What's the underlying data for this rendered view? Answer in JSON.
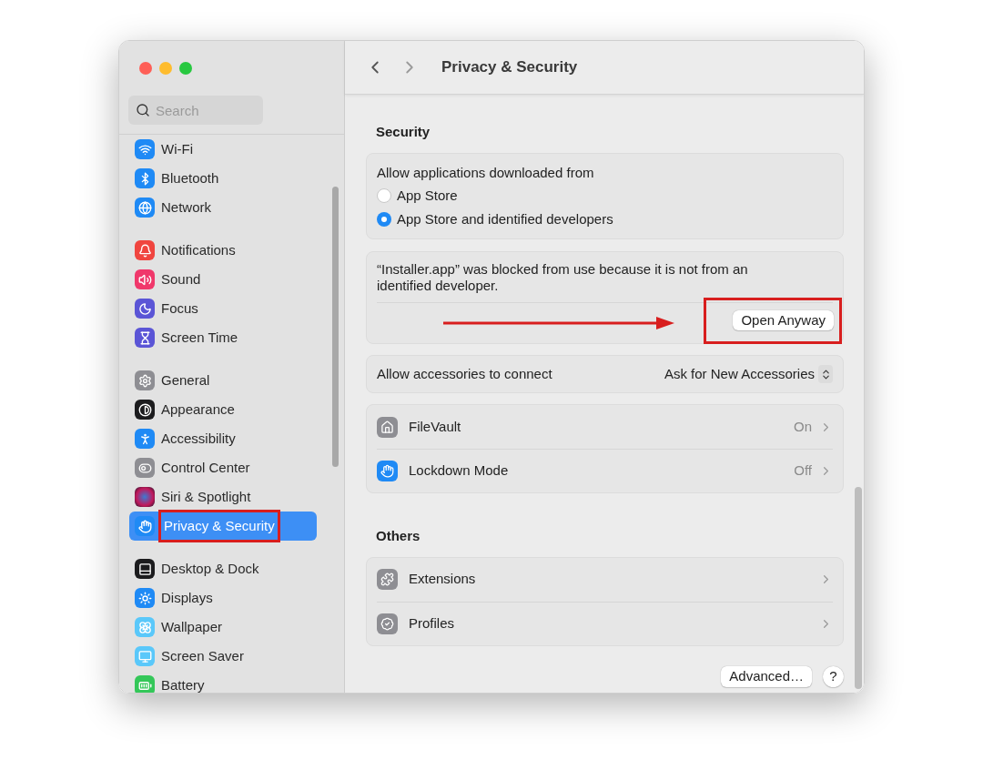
{
  "sidebar": {
    "search": {
      "placeholder": "Search"
    },
    "groups": [
      [
        {
          "label": "Wi-Fi",
          "selected": false
        },
        {
          "label": "Bluetooth",
          "selected": false
        },
        {
          "label": "Network",
          "selected": false
        }
      ],
      [
        {
          "label": "Notifications",
          "selected": false
        },
        {
          "label": "Sound",
          "selected": false
        },
        {
          "label": "Focus",
          "selected": false
        },
        {
          "label": "Screen Time",
          "selected": false
        }
      ],
      [
        {
          "label": "General",
          "selected": false
        },
        {
          "label": "Appearance",
          "selected": false
        },
        {
          "label": "Accessibility",
          "selected": false
        },
        {
          "label": "Control Center",
          "selected": false
        },
        {
          "label": "Siri & Spotlight",
          "selected": false
        },
        {
          "label": "Privacy & Security",
          "selected": true
        }
      ],
      [
        {
          "label": "Desktop & Dock",
          "selected": false
        },
        {
          "label": "Displays",
          "selected": false
        },
        {
          "label": "Wallpaper",
          "selected": false
        },
        {
          "label": "Screen Saver",
          "selected": false
        },
        {
          "label": "Battery",
          "selected": false
        }
      ]
    ]
  },
  "header": {
    "title": "Privacy & Security"
  },
  "security": {
    "heading": "Security",
    "downloads": {
      "label": "Allow applications downloaded from",
      "options": [
        {
          "label": "App Store",
          "selected": false
        },
        {
          "label": "App Store and identified developers",
          "selected": true
        }
      ]
    },
    "blocked": {
      "message": "“Installer.app” was blocked from use because it is not from an identified developer.",
      "button": "Open Anyway"
    },
    "accessories": {
      "label": "Allow accessories to connect",
      "value": "Ask for New Accessories"
    },
    "rows": [
      {
        "label": "FileVault",
        "value": "On"
      },
      {
        "label": "Lockdown Mode",
        "value": "Off"
      }
    ]
  },
  "others": {
    "heading": "Others",
    "rows": [
      {
        "label": "Extensions"
      },
      {
        "label": "Profiles"
      }
    ]
  },
  "footer": {
    "advanced": "Advanced…",
    "help": "?"
  }
}
